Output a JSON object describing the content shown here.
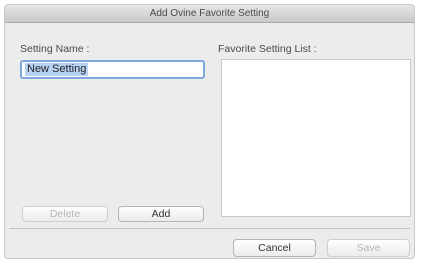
{
  "window": {
    "title": "Add Ovine Favorite Setting"
  },
  "form": {
    "setting_name_label": "Setting Name :",
    "setting_name_value": "New Setting",
    "favorite_list_label": "Favorite Setting List :",
    "favorite_list_items": []
  },
  "buttons": {
    "delete": "Delete",
    "add": "Add",
    "cancel": "Cancel",
    "save": "Save"
  }
}
